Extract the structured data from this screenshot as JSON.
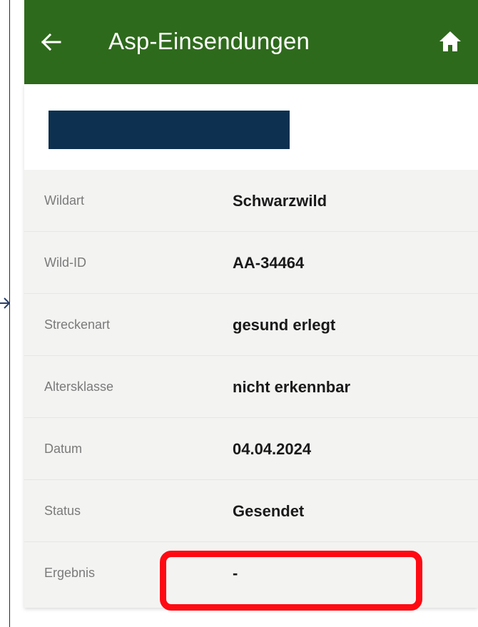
{
  "header": {
    "title": "Asp-Einsendungen",
    "back_icon": "arrow-left-icon",
    "home_icon": "home-icon",
    "background": "#2e6a1c"
  },
  "card": {
    "redacted_bar_color": "#0e3050"
  },
  "details": [
    {
      "label": "Wildart",
      "value": "Schwarzwild"
    },
    {
      "label": "Wild-ID",
      "value": "AA-34464"
    },
    {
      "label": "Streckenart",
      "value": "gesund erlegt"
    },
    {
      "label": "Altersklasse",
      "value": "nicht erkennbar"
    },
    {
      "label": "Datum",
      "value": "04.04.2024"
    },
    {
      "label": "Status",
      "value": "Gesendet"
    },
    {
      "label": "Ergebnis",
      "value": "-"
    }
  ],
  "annotation": {
    "highlight_color": "#ff0a12"
  }
}
